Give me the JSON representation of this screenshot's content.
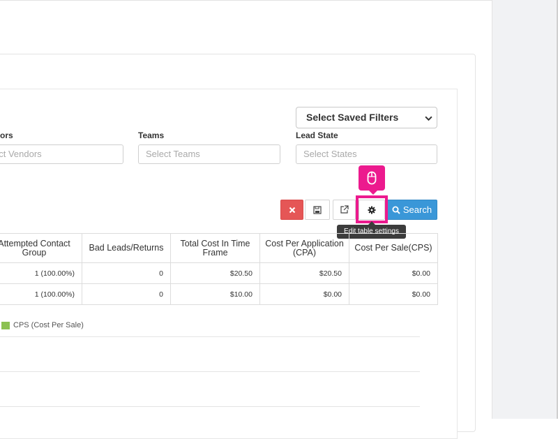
{
  "filters": {
    "saved_filters_value": "Select Saved Filters",
    "vendors_label": "ors",
    "vendors_placeholder": "ect Vendors",
    "teams_label": "Teams",
    "teams_placeholder": "Select Teams",
    "lead_state_label": "Lead State",
    "lead_state_placeholder": "Select States"
  },
  "toolbar": {
    "search_label": "Search",
    "settings_tooltip": "Edit table settings"
  },
  "table": {
    "headers": [
      "Attempted Contact Group",
      "Bad Leads/Returns",
      "Total Cost In Time Frame",
      "Cost Per Application (CPA)",
      "Cost Per Sale(CPS)"
    ],
    "rows": [
      [
        "1 (100.00%)",
        "0",
        "$20.50",
        "$20.50",
        "$0.00"
      ],
      [
        "1 (100.00%)",
        "0",
        "$10.00",
        "$0.00",
        "$0.00"
      ]
    ]
  },
  "legend": {
    "label": "CPS (Cost Per Sale)",
    "color": "#8cc152"
  },
  "colors": {
    "highlight": "#ec1a8e",
    "search_button": "#3a97d8",
    "clear_button": "#e55656"
  },
  "icons": {
    "clear": "times-icon",
    "save": "floppy-disk-icon",
    "export": "external-link-icon",
    "settings": "gear-icon",
    "search": "search-icon",
    "cursor": "mouse-icon"
  }
}
